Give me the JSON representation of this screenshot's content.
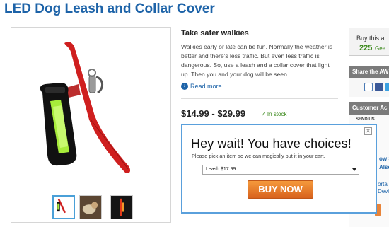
{
  "page": {
    "title": "LED Dog Leash and Collar Cover"
  },
  "product": {
    "subtitle": "Take safer walkies",
    "description": "Walkies early or late can be fun. Normally the weather is better and there's less traffic. But even less traffic is dangerous. So, use a leash and a collar cover that light up. Then you and your dog will be seen.",
    "read_more": "Read more...",
    "price_range": "$14.99 - $29.99",
    "stock_status": "✓ In stock"
  },
  "sidebar": {
    "buy_this": "Buy this a",
    "geek_points": "225",
    "geek_label": "Gee",
    "share_heading": "Share the AW",
    "contact_heading": "Customer Ac",
    "send_label": "SEND US",
    "glimpse_lines": [
      "ow S",
      "Also",
      "ortal",
      "Devi"
    ]
  },
  "popup": {
    "title": "Hey wait! You have choices!",
    "subtitle": "Please pick an item so we can magically put it in your cart.",
    "selected_option": "Leash $17.99",
    "buy_label": "BUY NOW",
    "close_symbol": "✕"
  },
  "colors": {
    "title_blue": "#1d63a8",
    "in_stock_green": "#3d8a1e",
    "buy_orange": "#e07a2c",
    "popup_border": "#5aa0dc",
    "leash_red": "#cf1f1f",
    "collar_green": "#9ee33a"
  }
}
